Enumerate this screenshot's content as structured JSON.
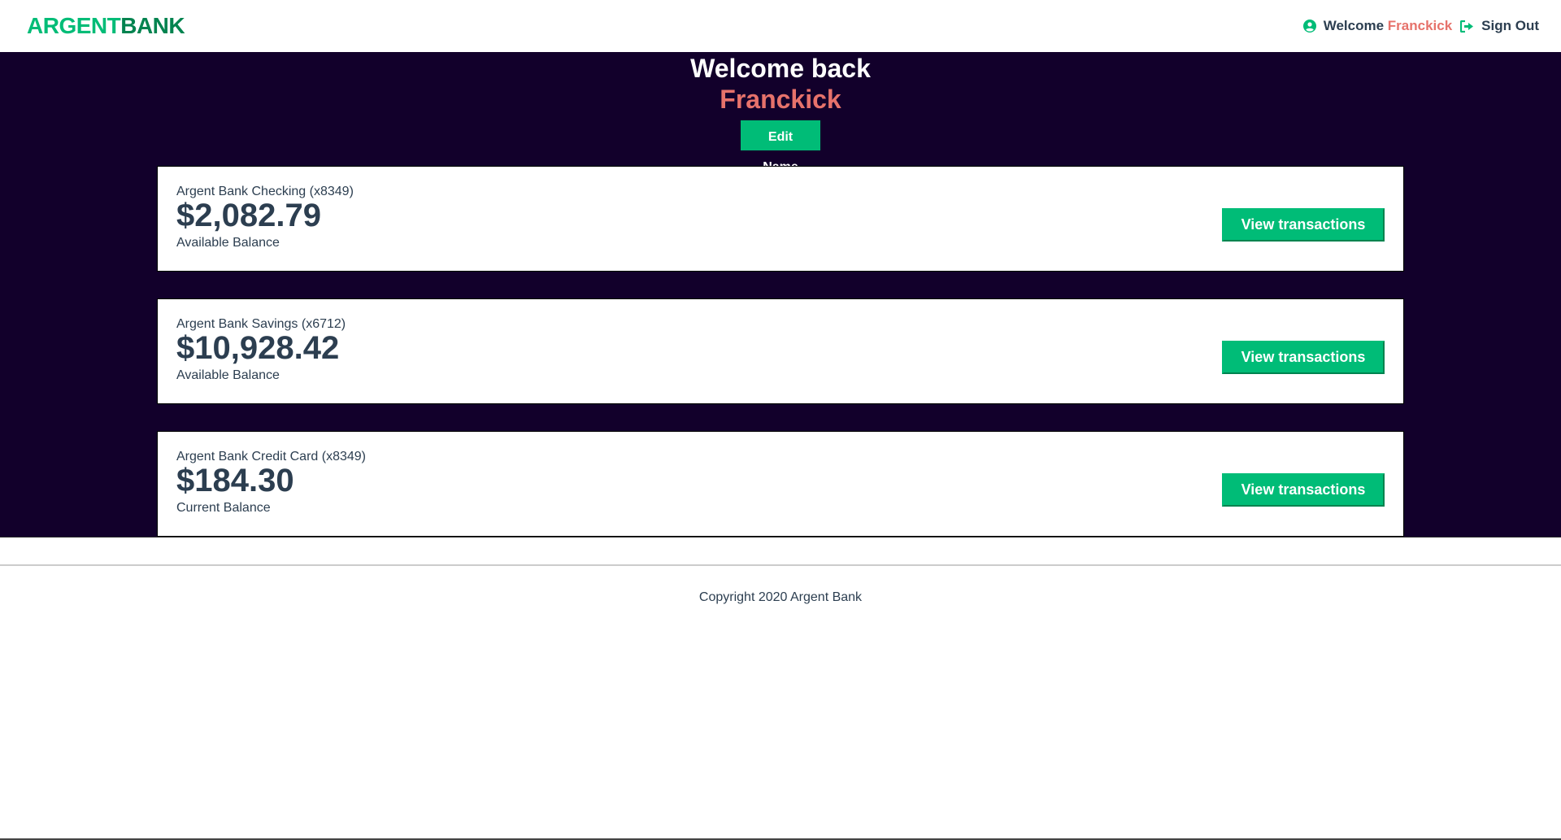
{
  "nav": {
    "logo_part1": "ARGENT",
    "logo_part2": "BANK",
    "welcome_label": "Welcome",
    "user_name": "Franckick",
    "sign_out_label": "Sign Out",
    "user_icon": "user-circle-icon",
    "sign_out_icon": "sign-out-icon"
  },
  "header": {
    "welcome": "Welcome back",
    "name": "Franckick",
    "edit_button": "Edit Name"
  },
  "accounts": [
    {
      "title": "Argent Bank Checking (x8349)",
      "amount": "$2,082.79",
      "description": "Available Balance",
      "button": "View transactions"
    },
    {
      "title": "Argent Bank Savings (x6712)",
      "amount": "$10,928.42",
      "description": "Available Balance",
      "button": "View transactions"
    },
    {
      "title": "Argent Bank Credit Card (x8349)",
      "amount": "$184.30",
      "description": "Current Balance",
      "button": "View transactions"
    }
  ],
  "footer": {
    "copyright": "Copyright 2020 Argent Bank"
  },
  "colors": {
    "brand_green": "#00bc77",
    "brand_dark_green": "#00834f",
    "accent_salmon": "#e6726b",
    "main_background": "#12002b",
    "text": "#2c3e50"
  }
}
